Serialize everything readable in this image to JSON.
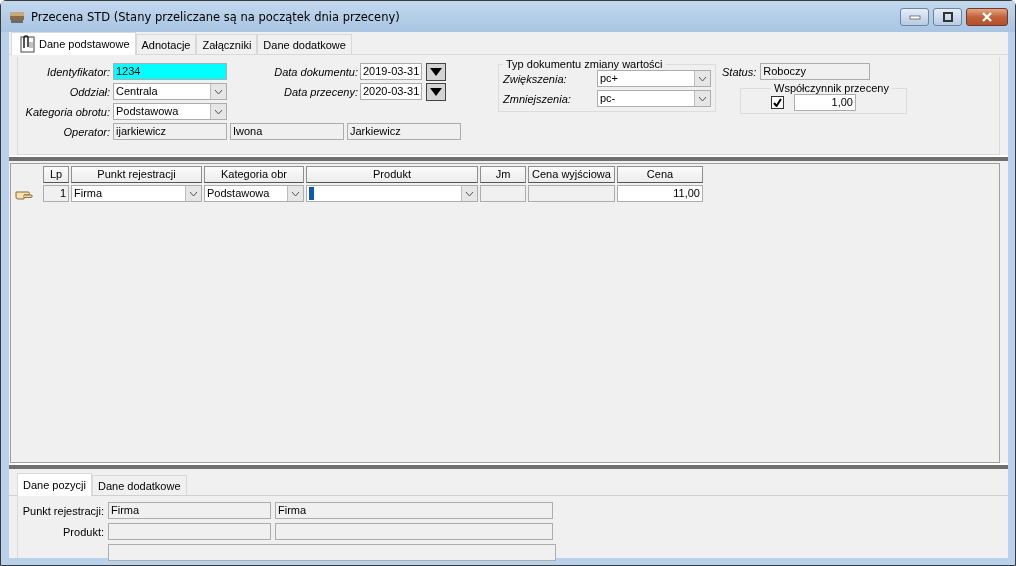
{
  "window": {
    "title": "Przecena STD (Stany przeliczane są na początek dnia przeceny)"
  },
  "tabs": [
    {
      "label": "Dane podstawowe",
      "selected": true
    },
    {
      "label": "Adnotacje",
      "selected": false
    },
    {
      "label": "Załączniki",
      "selected": false
    },
    {
      "label": "Dane dodatkowe",
      "selected": false
    }
  ],
  "header": {
    "left": [
      {
        "kind": "text",
        "label": "Identyfikator:",
        "value": "1234",
        "highlighted": true
      },
      {
        "kind": "combo",
        "label": "Oddział:",
        "value": "Centrala"
      },
      {
        "kind": "combo",
        "label": "Kategoria obrotu:",
        "value": "Podstawowa"
      },
      {
        "kind": "readonly",
        "label": "Operator:",
        "values": [
          "ijarkiewicz",
          "Iwona",
          "Jarkiewicz"
        ]
      }
    ],
    "dates": [
      {
        "label": "Data dokumentu:",
        "value": "2019-03-31"
      },
      {
        "label": "Data przeceny:",
        "value": "2020-03-31"
      }
    ],
    "document_type": {
      "title": "Typ dokumentu zmiany wartości",
      "rows": [
        {
          "label": "Zwiększenia:",
          "value": "pc+"
        },
        {
          "label": "Zmniejszenia:",
          "value": "pc-"
        }
      ]
    },
    "status": {
      "label": "Status:",
      "value": "Roboczy"
    },
    "factor": {
      "title": "Współczynnik przeceny",
      "checked": true,
      "value": "1,00"
    }
  },
  "grid": {
    "columns": [
      "Lp",
      "Punkt rejestracji",
      "Kategoria obr",
      "Produkt",
      "Jm",
      "Cena wyjściowa",
      "Cena"
    ],
    "rows": [
      {
        "selected": true,
        "lp": "1",
        "punkt_rejestracji": "Firma",
        "kategoria_obr": "Podstawowa",
        "cena": "11,00"
      }
    ]
  },
  "bottom_tabs": [
    {
      "label": "Dane pozycji",
      "selected": true
    },
    {
      "label": "Dane dodatkowe",
      "selected": false
    }
  ],
  "bottom_panel": {
    "rows": [
      {
        "label": "Punkt rejestracji:",
        "values": [
          "Firma",
          "Firma"
        ]
      },
      {
        "label": "Produkt:"
      }
    ]
  }
}
